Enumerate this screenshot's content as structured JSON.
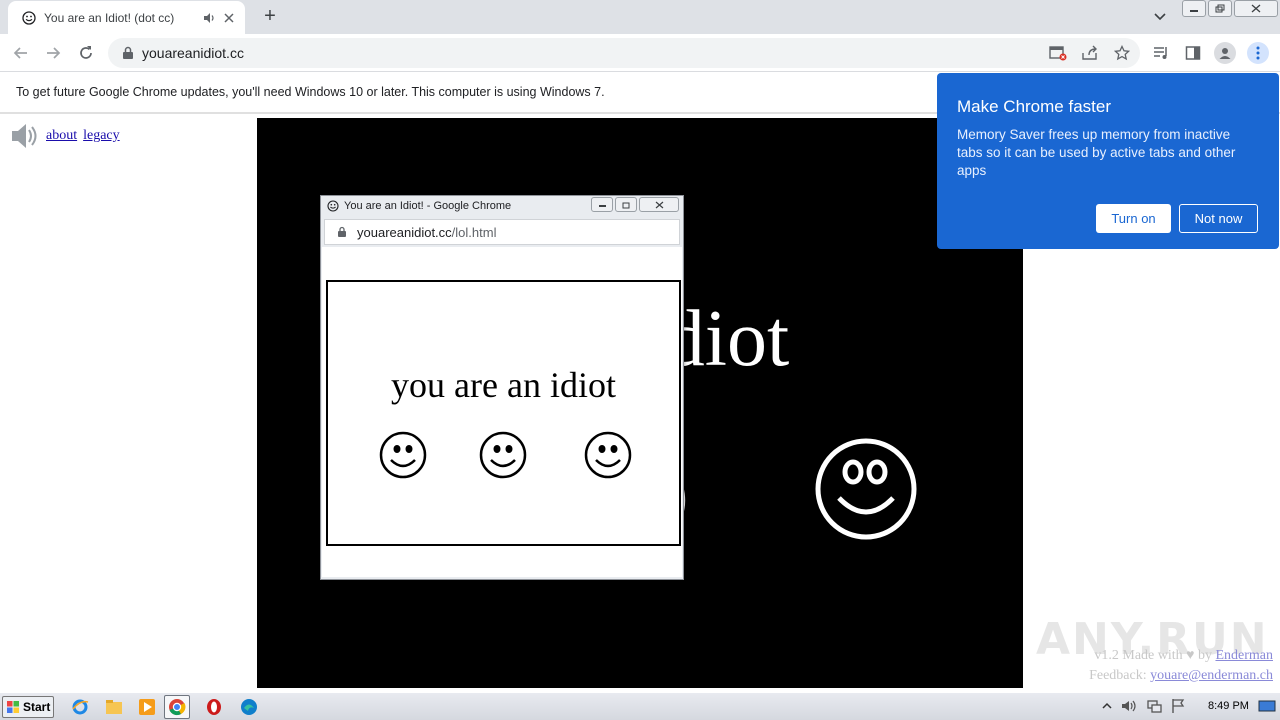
{
  "browser": {
    "tab": {
      "title": "You are an Idiot! (dot cc)"
    },
    "new_tab_symbol": "+",
    "address": {
      "url": "youareanidiot.cc"
    }
  },
  "infobar": {
    "message": "To get future Google Chrome updates, you'll need Windows 10 or later. This computer is using Windows 7."
  },
  "page": {
    "links": [
      "about",
      "legacy"
    ],
    "big_text": "an idiot",
    "credit_line1_prefix": "v1.2 Made with ♥ by ",
    "credit_author": "Enderman",
    "credit_line2_prefix": "Feedback: ",
    "credit_email": "youare@enderman.ch",
    "watermark": "ANY.RUN"
  },
  "popup": {
    "window_title": "You are an Idiot! - Google Chrome",
    "url_host": "youareanidiot.cc",
    "url_path": "/lol.html",
    "text": "you are an idiot"
  },
  "bubble": {
    "title": "Make Chrome faster",
    "body": "Memory Saver frees up memory from inactive tabs so it can be used by active tabs and other apps",
    "turn_on": "Turn on",
    "not_now": "Not now"
  },
  "taskbar": {
    "start_label": "Start",
    "clock": "8:49 PM"
  },
  "colors": {
    "bubble_blue": "#1a67d2",
    "stage_black": "#000000"
  }
}
